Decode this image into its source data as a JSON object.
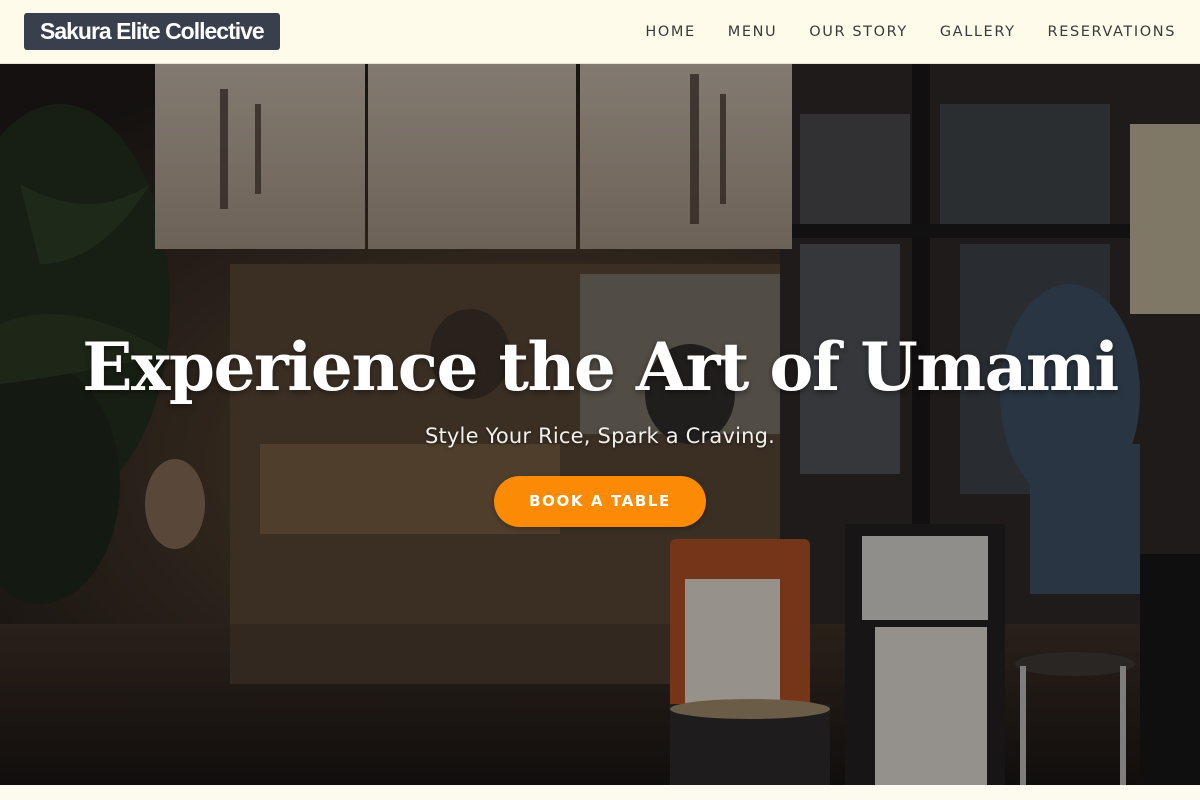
{
  "navbar": {
    "brand": "Sakura Elite Collective",
    "links": [
      "HOME",
      "MENU",
      "OUR STORY",
      "GALLERY",
      "RESERVATIONS"
    ]
  },
  "hero": {
    "title": "Experience the Art of Umami",
    "subtitle": "Style Your Rice, Spark a Craving.",
    "cta_label": "BOOK A TABLE",
    "background": "restaurant-storefront-night-photo"
  },
  "colors": {
    "nav_bg": "#fefbeb",
    "brand_bg": "#3a3f4e",
    "cta": "#fb8b05",
    "text_light": "#ffffff"
  }
}
